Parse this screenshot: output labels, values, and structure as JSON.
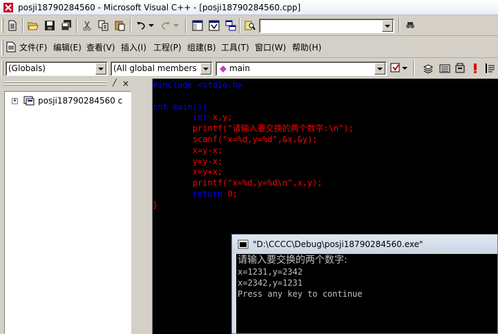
{
  "window": {
    "title": "posji18790284560 - Microsoft Visual C++ - [posji18790284560.cpp]"
  },
  "menu": {
    "items": [
      "文件(F)",
      "编辑(E)",
      "查看(V)",
      "插入(I)",
      "工程(P)",
      "组建(B)",
      "工具(T)",
      "窗口(W)",
      "帮助(H)"
    ]
  },
  "toolbar": {
    "find_value": "",
    "icons": [
      "new-file-icon",
      "open-icon",
      "save-icon",
      "save-all-icon",
      "cut-icon",
      "copy-icon",
      "paste-icon",
      "undo-icon",
      "redo-icon",
      "workspace-icon",
      "output-icon",
      "window-list-icon",
      "find-in-files-icon",
      "find-icon"
    ]
  },
  "wizard_bar": {
    "class_combo": "(Globals)",
    "filter_combo": "(All global members",
    "member_combo": "main",
    "icons": [
      "wizard-action-icon",
      "compile-icon",
      "build-icon",
      "stop-build-icon",
      "execute-icon",
      "insert-breakpoint-icon"
    ]
  },
  "workspace": {
    "tree_root": "posji18790284560 c"
  },
  "editor": {
    "lines": [
      {
        "segments": [
          {
            "t": "#include <stdio.h>",
            "c": "kw"
          }
        ]
      },
      {
        "segments": []
      },
      {
        "segments": [
          {
            "t": "int main(){",
            "c": "kw"
          }
        ]
      },
      {
        "segments": [
          {
            "t": "        ",
            "c": "tx"
          },
          {
            "t": "int",
            "c": "kw"
          },
          {
            "t": " x,y;",
            "c": "tx"
          }
        ]
      },
      {
        "segments": [
          {
            "t": "        printf(\"请输入要交换的两个数字:\\n\");",
            "c": "tx"
          }
        ]
      },
      {
        "segments": [
          {
            "t": "        scanf(\"x=%d,y=%d\",&x,&y);",
            "c": "tx"
          }
        ]
      },
      {
        "segments": [
          {
            "t": "        x=y-x;",
            "c": "tx"
          }
        ]
      },
      {
        "segments": [
          {
            "t": "        y=y-x;",
            "c": "tx"
          }
        ]
      },
      {
        "segments": [
          {
            "t": "        x=y+x;",
            "c": "tx"
          }
        ]
      },
      {
        "segments": [
          {
            "t": "        printf(\"x=%d,y=%d\\n\",x,y);",
            "c": "tx"
          }
        ]
      },
      {
        "segments": [
          {
            "t": "        ",
            "c": "tx"
          },
          {
            "t": "return",
            "c": "kw"
          },
          {
            "t": " 0;",
            "c": "tx"
          }
        ]
      },
      {
        "segments": [
          {
            "t": "}",
            "c": "tx"
          }
        ]
      }
    ]
  },
  "console": {
    "title": "\"D:\\CCCC\\Debug\\posji18790284560.exe\"",
    "lines": [
      "请输入要交换的两个数字:",
      "x=1231,y=2342",
      "x=2342,y=1231",
      "Press any key to continue"
    ]
  },
  "colors": {
    "editor_bg": "#000000",
    "keyword": "#0000ff",
    "text": "#ff0000",
    "console_text": "#c0c0c0"
  }
}
